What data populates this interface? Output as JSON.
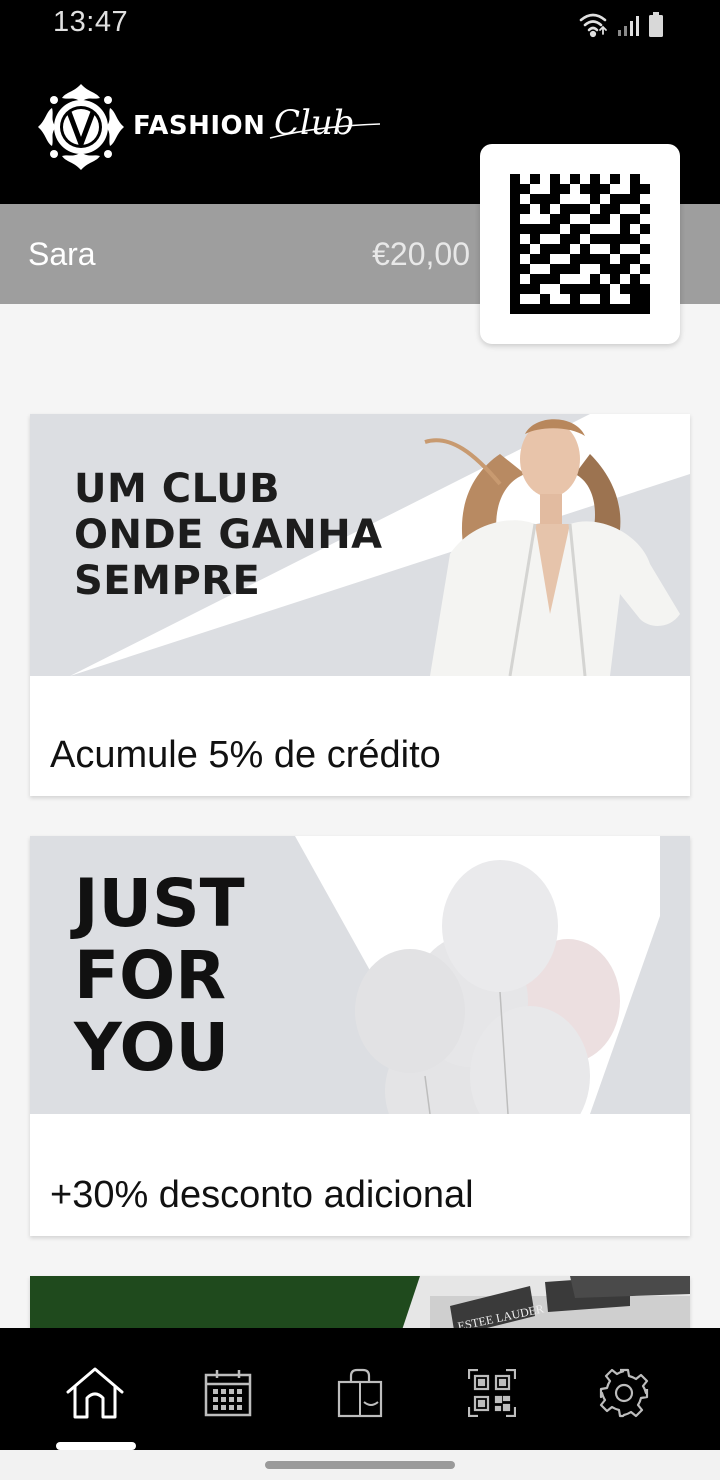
{
  "status_bar": {
    "time": "13:47",
    "icons": [
      "wifi-icon",
      "signal-icon",
      "battery-icon"
    ]
  },
  "brand": {
    "logo_emblem": "vc-emblem",
    "name_bold": "FASHION",
    "name_script": "Club"
  },
  "account": {
    "user_name": "Sara",
    "balance": "€20,00",
    "code_icon": "qr-code-icon"
  },
  "promos": [
    {
      "headline": [
        "UM CLUB",
        "ONDE GANHA",
        "SEMPRE"
      ],
      "caption": "Acumule 5% de crédito"
    },
    {
      "headline": [
        "JUST",
        "FOR",
        "YOU"
      ],
      "caption": "+30% desconto adicional"
    },
    {
      "image_text": "ESTEE LAUDER"
    }
  ],
  "bottom_nav": {
    "items": [
      "home-icon",
      "calendar-icon",
      "shopping-bag-icon",
      "qr-code-icon",
      "settings-icon"
    ],
    "active": "home-icon"
  },
  "colors": {
    "header_bg": "#000000",
    "account_bar_bg": "#9e9e9e",
    "page_bg": "#f5f5f5",
    "promo_image_bg": "#dcdee2",
    "promo_green": "#1f4a1d"
  }
}
